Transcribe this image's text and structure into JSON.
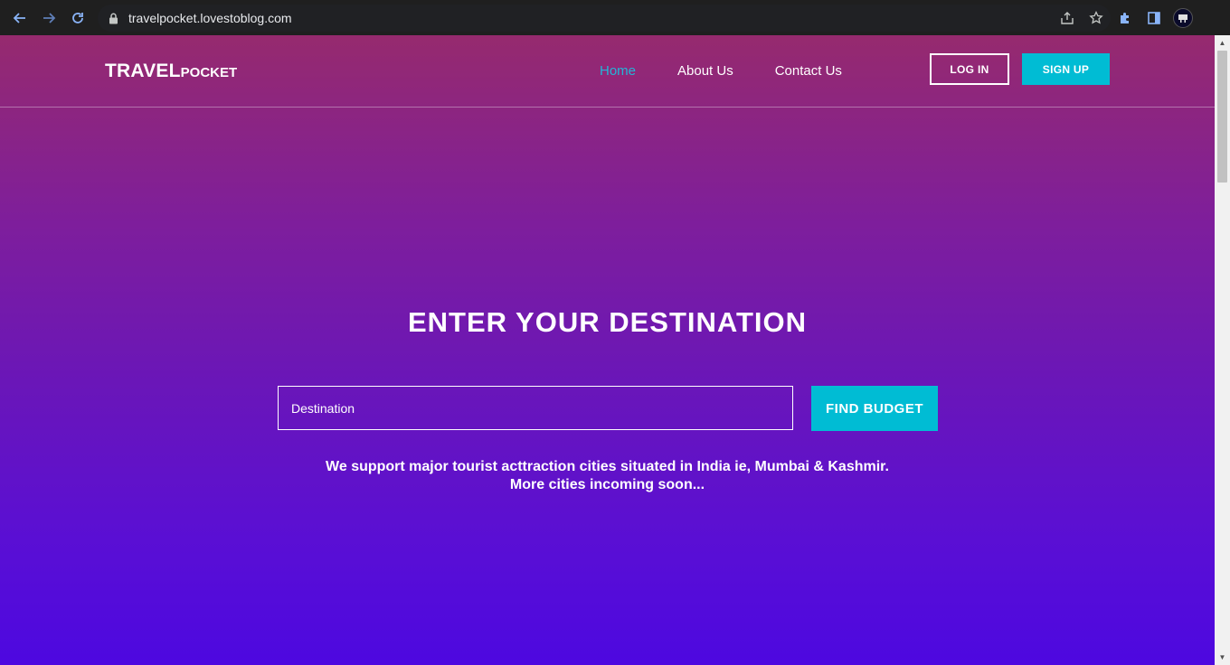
{
  "browser": {
    "url": "travelpocket.lovestoblog.com"
  },
  "site": {
    "logo_big": "TRAVEL",
    "logo_small": "POCKET",
    "menu": [
      {
        "label": "Home",
        "active": true
      },
      {
        "label": "About Us",
        "active": false
      },
      {
        "label": "Contact Us",
        "active": false
      }
    ],
    "login_label": "LOG IN",
    "signup_label": "SIGN UP"
  },
  "hero": {
    "title": "ENTER YOUR DESTINATION",
    "input_placeholder": "Destination",
    "find_label": "FIND BUDGET",
    "support_line1": "We support major tourist acttraction cities situated in India ie, Mumbai & Kashmir.",
    "support_line2": "More cities incoming soon..."
  },
  "colors": {
    "accent": "#00bcd4",
    "active_link": "#22b6d8",
    "gradient_top": "#962a6e",
    "gradient_bottom": "#4d08e0"
  }
}
